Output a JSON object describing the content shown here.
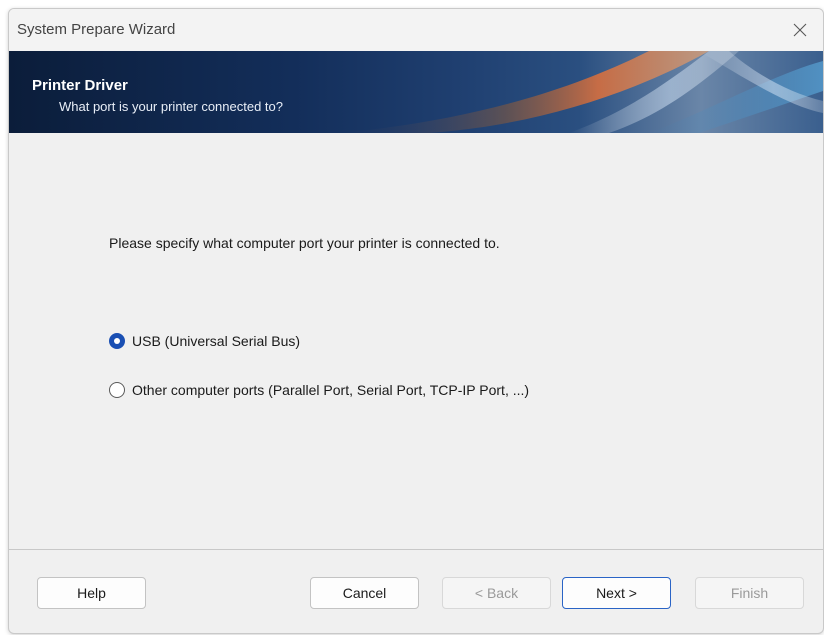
{
  "window": {
    "title": "System Prepare Wizard"
  },
  "titlebar": {
    "close_icon": "close-icon"
  },
  "banner": {
    "title": "Printer Driver",
    "subtitle": "What port is your printer connected to?"
  },
  "main": {
    "prompt": "Please specify what computer port your printer is connected to.",
    "options": [
      {
        "label": "USB (Universal Serial Bus)",
        "selected": true
      },
      {
        "label": "Other computer ports (Parallel Port, Serial Port, TCP-IP Port, ...)",
        "selected": false
      }
    ]
  },
  "footer": {
    "help": "Help",
    "cancel": "Cancel",
    "back": "< Back",
    "next": "Next >",
    "finish": "Finish"
  },
  "colors": {
    "accent": "#1a4fb3",
    "default_button_border": "#2a64c6",
    "banner_dark": "#0b1d3a"
  }
}
